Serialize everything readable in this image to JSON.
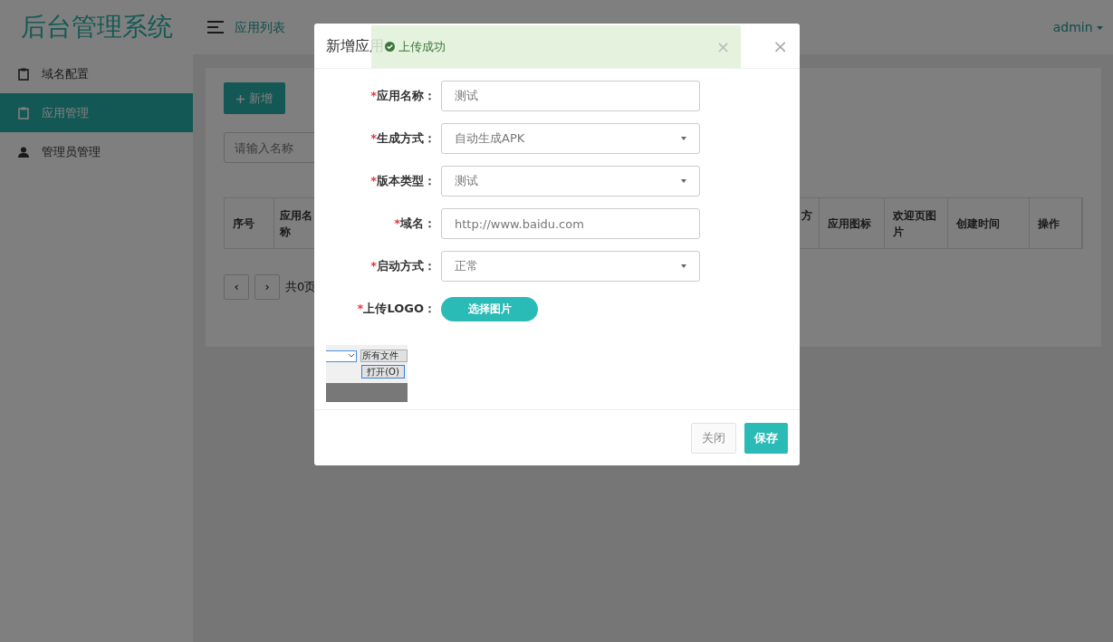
{
  "logo": "后台管理系统",
  "sidebar": {
    "items": [
      {
        "label": "域名配置",
        "kind": "clipboard",
        "selected": false
      },
      {
        "label": "应用管理",
        "kind": "clipboard",
        "selected": true
      },
      {
        "label": "管理员管理",
        "kind": "person",
        "selected": false
      }
    ]
  },
  "header": {
    "title": "应用列表",
    "user": "admin"
  },
  "content": {
    "add_button": "新增",
    "search": {
      "placeholder": "请输入名称"
    },
    "table": {
      "columns": [
        "序号",
        "应用名称",
        "方",
        "应用图标",
        "欢迎页图片",
        "创建时间",
        "操作"
      ]
    },
    "pagination": {
      "prev": "‹",
      "next": "›",
      "summary": "共0页"
    }
  },
  "modal": {
    "title": "新增应用",
    "close": "×",
    "fields": [
      {
        "kind": "input",
        "required_mark": "*",
        "label": "应用名称：",
        "value": "测试"
      },
      {
        "kind": "select",
        "required_mark": "*",
        "label": "生成方式：",
        "value": "自动生成APK"
      },
      {
        "kind": "select",
        "required_mark": "*",
        "label": "版本类型：",
        "value": "测试"
      },
      {
        "kind": "input",
        "required_mark": "*",
        "label": "域名：",
        "value": "http://www.baidu.com"
      },
      {
        "kind": "select",
        "required_mark": "*",
        "label": "启动方式：",
        "value": "正常"
      },
      {
        "kind": "upload",
        "required_mark": "*",
        "label": "上传LOGO：",
        "value": "选择图片"
      }
    ],
    "preview": {
      "filter": "所有文件",
      "button": "打开(O)"
    },
    "buttons": [
      {
        "label": "关闭",
        "kind": "secondary"
      },
      {
        "label": "保存",
        "kind": "primary"
      }
    ]
  },
  "toast": {
    "message": "上传成功",
    "close": "×"
  }
}
